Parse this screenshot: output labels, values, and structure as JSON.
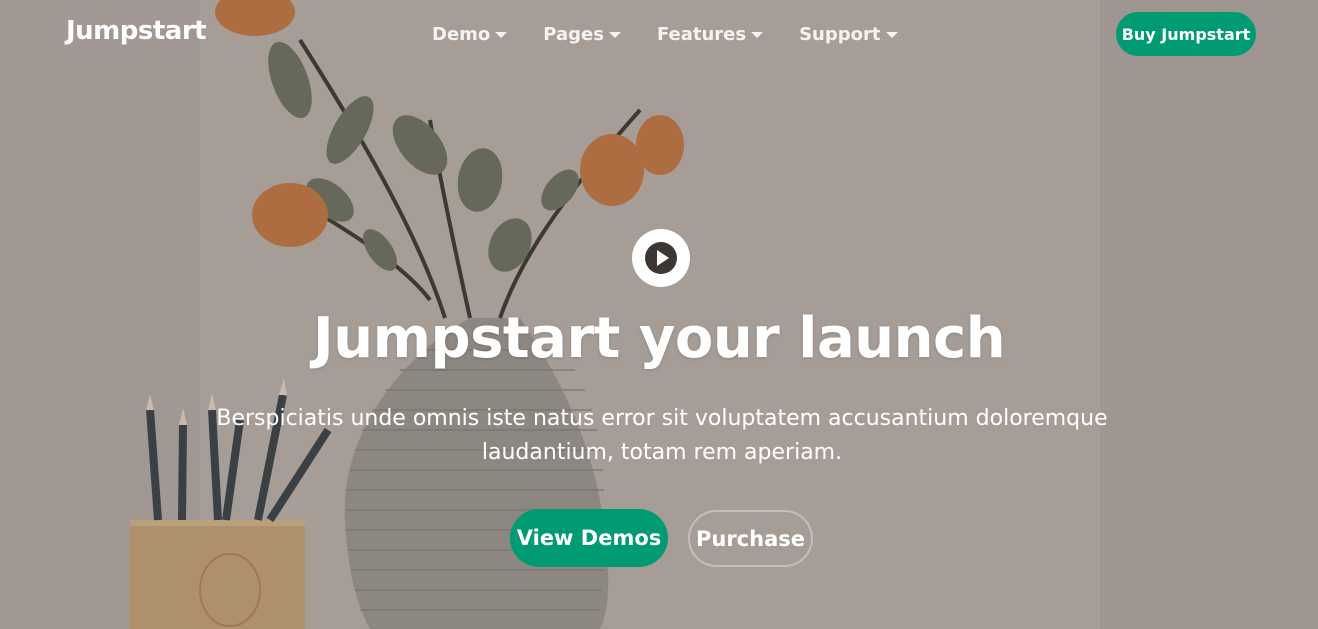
{
  "navbar": {
    "brand": "Jumpstart",
    "items": [
      {
        "label": "Demo"
      },
      {
        "label": "Pages"
      },
      {
        "label": "Features"
      },
      {
        "label": "Support"
      }
    ],
    "cta_label": "Buy Jumpstart"
  },
  "hero": {
    "play_icon": "play-icon",
    "title": "Jumpstart your launch",
    "subtitle": "Berspiciatis unde omnis iste natus error sit voluptatem accusantium doloremque laudantium, totam rem aperiam.",
    "primary_button": "View Demos",
    "secondary_button": "Purchase"
  },
  "colors": {
    "accent": "#009b72",
    "text": "#ffffff"
  }
}
